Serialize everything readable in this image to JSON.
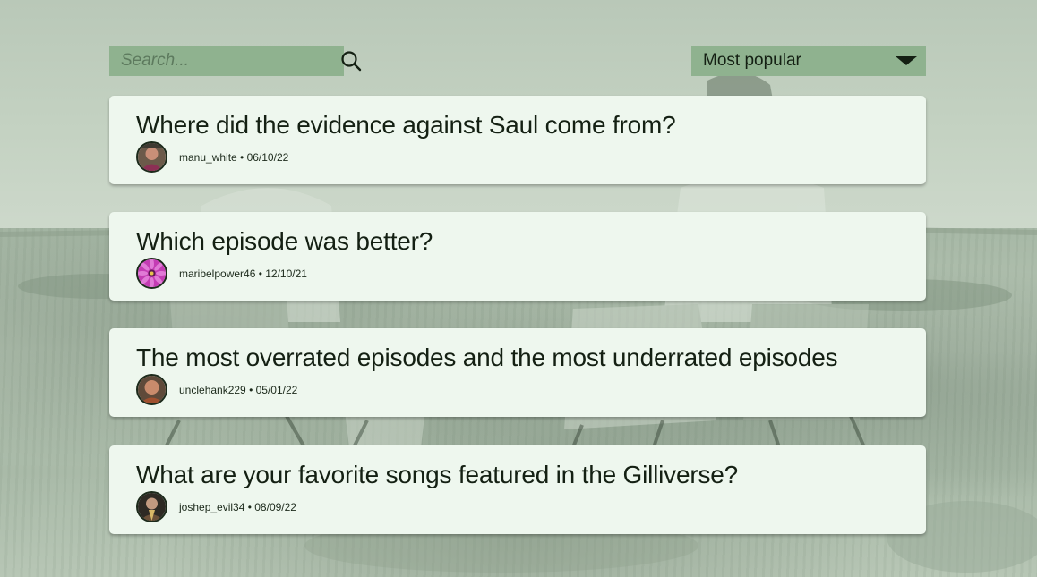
{
  "search": {
    "placeholder": "Search...",
    "value": ""
  },
  "sort": {
    "selected": "Most popular"
  },
  "threads": [
    {
      "title": "Where did the evidence against Saul come from?",
      "author": "manu_white",
      "date": "06/10/22",
      "meta": "manu_white • 06/10/22"
    },
    {
      "title": "Which episode was better?",
      "author": "maribelpower46",
      "date": "12/10/21",
      "meta": "maribelpower46 • 12/10/21"
    },
    {
      "title": "The most overrated episodes and the most underrated episodes",
      "author": "unclehank229",
      "date": "05/01/22",
      "meta": "unclehank229 • 05/01/22"
    },
    {
      "title": "What are your favorite songs featured in the Gilliverse?",
      "author": "joshep_evil34",
      "date": "08/09/22",
      "meta": "joshep_evil34 • 08/09/22"
    }
  ],
  "colors": {
    "control_bg": "#8fb28f",
    "card_bg": "#eef7ee",
    "text_dark": "#142013"
  },
  "icons": {
    "search": "search-icon",
    "dropdown": "caret-down-icon"
  }
}
